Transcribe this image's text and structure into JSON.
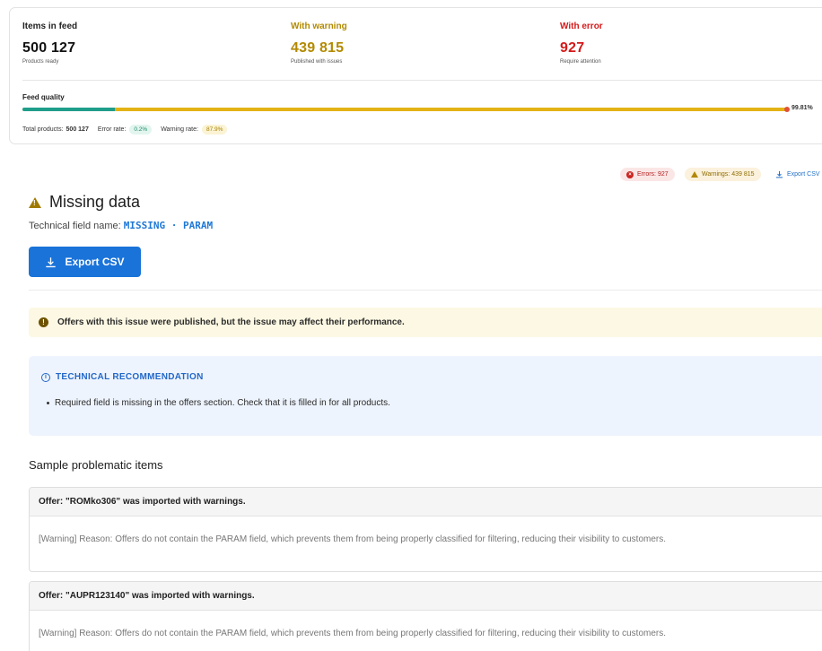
{
  "summary": {
    "items_in_feed": {
      "label": "Items in feed",
      "value": "500 127",
      "sub": "Products ready"
    },
    "with_warning": {
      "label": "With warning",
      "value": "439 815",
      "sub": "Published with issues"
    },
    "with_error": {
      "label": "With error",
      "value": "927",
      "sub": "Require attention"
    }
  },
  "quality": {
    "title": "Feed quality",
    "percent_label": "99.81%",
    "ok_fraction": 0.121,
    "total_label": "Total products:",
    "total_value": "500 127",
    "error_rate_label": "Error rate:",
    "error_rate_value": "0.2%",
    "warning_rate_label": "Warning rate:",
    "warning_rate_value": "87.9%"
  },
  "top_actions": {
    "errors_badge": "Errors: 927",
    "warnings_badge": "Warnings: 439 815",
    "export_link": "Export CSV"
  },
  "issue": {
    "title": "Missing data",
    "tech_label": "Technical field name:",
    "tech_code": "MISSING · PARAM",
    "export_button": "Export CSV",
    "notice": "Offers with this issue were published, but the issue may affect their performance.",
    "recommendation_title": "TECHNICAL RECOMMENDATION",
    "recommendation_text": "Required field is missing in the offers section. Check that it is filled in for all products."
  },
  "samples": {
    "title": "Sample problematic items",
    "items": [
      {
        "header": "Offer: \"ROMko306\" was imported with warnings.",
        "body": "[Warning] Reason: Offers do not contain the PARAM field, which prevents them from being properly classified for filtering, reducing their visibility to customers."
      },
      {
        "header": "Offer: \"AUPR123140\" was imported with warnings.",
        "body": "[Warning] Reason: Offers do not contain the PARAM field, which prevents them from being properly classified for filtering, reducing their visibility to customers."
      }
    ]
  },
  "colors": {
    "accent_blue": "#1a73d9",
    "warning": "#b38a00",
    "error": "#d41a1a",
    "ok_green": "#1f9e8c"
  },
  "icons": [
    "close-circle-icon",
    "warning-triangle-icon",
    "download-icon",
    "alert-circle-icon",
    "info-icon"
  ]
}
